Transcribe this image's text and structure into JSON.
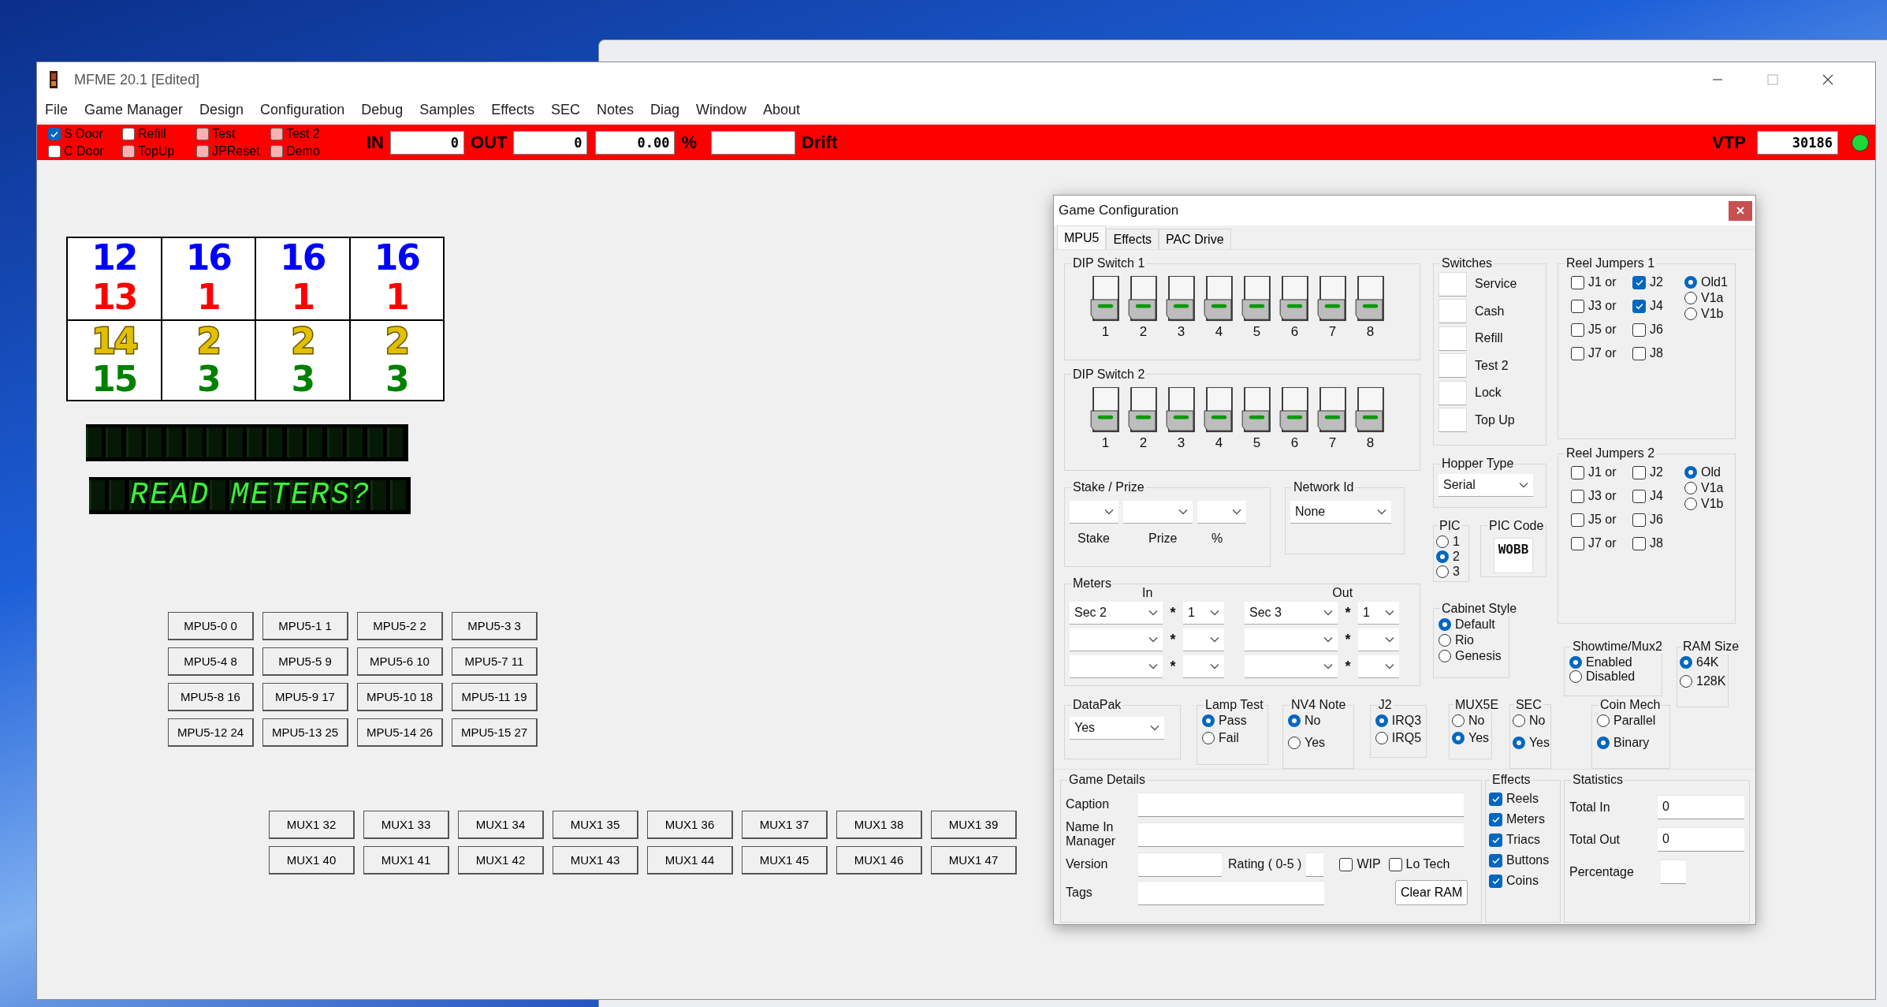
{
  "window": {
    "title": "MFME 20.1 [Edited]"
  },
  "menu": [
    "File",
    "Game Manager",
    "Design",
    "Configuration",
    "Debug",
    "Samples",
    "Effects",
    "SEC",
    "Notes",
    "Diag",
    "Window",
    "About"
  ],
  "toolbar": {
    "checks": [
      {
        "label": "S Door",
        "checked": true
      },
      {
        "label": "C Door",
        "checked": false,
        "color": "#ffffff"
      },
      {
        "label": "Refill",
        "checked": false,
        "color": "#ffffff"
      },
      {
        "label": "TopUp",
        "checked": false,
        "color": "#ffb0b0"
      },
      {
        "label": "Test",
        "checked": false,
        "color": "#ffb0b0"
      },
      {
        "label": "JPReset",
        "checked": false,
        "color": "#ffb0b0"
      },
      {
        "label": "Test 2",
        "checked": false,
        "color": "#ffb0b0"
      },
      {
        "label": "Demo",
        "checked": false,
        "color": "#ffb0b0"
      }
    ],
    "in": {
      "label": "IN",
      "value": "0"
    },
    "out": {
      "label": "OUT",
      "value": "0"
    },
    "percentage": {
      "value": "0.00",
      "unit": "%"
    },
    "drift": {
      "label": "Drift"
    },
    "vtp": {
      "label": "VTP",
      "value": "30186",
      "lamp_on": true
    }
  },
  "reels": [
    {
      "symbols": [
        {
          "text": "12",
          "color": "#0000ff"
        },
        {
          "text": "13",
          "color": "#ff0000"
        },
        {
          "text": "14",
          "color": "#e0c000"
        },
        {
          "text": "15",
          "color": "#008000"
        }
      ]
    },
    {
      "symbols": [
        {
          "text": "16",
          "color": "#0000ff"
        },
        {
          "text": "1",
          "color": "#ff0000"
        },
        {
          "text": "2",
          "color": "#e0c000"
        },
        {
          "text": "3",
          "color": "#008000"
        }
      ]
    },
    {
      "symbols": [
        {
          "text": "16",
          "color": "#0000ff"
        },
        {
          "text": "1",
          "color": "#ff0000"
        },
        {
          "text": "2",
          "color": "#e0c000"
        },
        {
          "text": "3",
          "color": "#008000"
        }
      ]
    },
    {
      "symbols": [
        {
          "text": "16",
          "color": "#0000ff"
        },
        {
          "text": "1",
          "color": "#ff0000"
        },
        {
          "text": "2",
          "color": "#e0c000"
        },
        {
          "text": "3",
          "color": "#008000"
        }
      ]
    }
  ],
  "display": {
    "text": "READ METERS?"
  },
  "lamp_buttons": [
    "MPU5-0 0",
    "MPU5-1 1",
    "MPU5-2 2",
    "MPU5-3 3",
    "MPU5-4 8",
    "MPU5-5 9",
    "MPU5-6 10",
    "MPU5-7 11",
    "MPU5-8 16",
    "MPU5-9 17",
    "MPU5-10 18",
    "MPU5-11 19",
    "MPU5-12 24",
    "MPU5-13 25",
    "MPU5-14 26",
    "MPU5-15 27"
  ],
  "mux_buttons": [
    "MUX1 32",
    "MUX1 33",
    "MUX1 34",
    "MUX1 35",
    "MUX1 36",
    "MUX1 37",
    "MUX1 38",
    "MUX1 39",
    "MUX1 40",
    "MUX1 41",
    "MUX1 42",
    "MUX1 43",
    "MUX1 44",
    "MUX1 45",
    "MUX1 46",
    "MUX1 47"
  ],
  "dialog": {
    "title": "Game Configuration",
    "tabs": [
      {
        "label": "MPU5",
        "selected": true
      },
      {
        "label": "Effects",
        "selected": false
      },
      {
        "label": "PAC Drive",
        "selected": false
      }
    ],
    "dip_switches": [
      {
        "title": "DIP Switch 1",
        "switches": [
          {
            "label": "1",
            "on": false
          },
          {
            "label": "2",
            "on": false
          },
          {
            "label": "3",
            "on": false
          },
          {
            "label": "4",
            "on": false
          },
          {
            "label": "5",
            "on": false
          },
          {
            "label": "6",
            "on": false
          },
          {
            "label": "7",
            "on": false
          },
          {
            "label": "8",
            "on": false
          }
        ]
      },
      {
        "title": "DIP Switch 2",
        "switches": [
          {
            "label": "1",
            "on": false
          },
          {
            "label": "2",
            "on": false
          },
          {
            "label": "3",
            "on": false
          },
          {
            "label": "4",
            "on": false
          },
          {
            "label": "5",
            "on": false
          },
          {
            "label": "6",
            "on": false
          },
          {
            "label": "7",
            "on": false
          },
          {
            "label": "8",
            "on": false
          }
        ]
      }
    ],
    "switches": {
      "title": "Switches",
      "items": [
        "Service",
        "Cash",
        "Refill",
        "Test 2",
        "Lock",
        "Top Up"
      ]
    },
    "reel_jumpers": [
      {
        "title": "Reel Jumpers 1",
        "jumpers": [
          {
            "label": "J1 or",
            "checked": false
          },
          {
            "label": "J2",
            "checked": true
          },
          {
            "label": "J3 or",
            "checked": false
          },
          {
            "label": "J4",
            "checked": true
          },
          {
            "label": "J5 or",
            "checked": false
          },
          {
            "label": "J6",
            "checked": false
          },
          {
            "label": "J7 or",
            "checked": false
          },
          {
            "label": "J8",
            "checked": false
          }
        ],
        "options": [
          {
            "label": "Old1",
            "selected": true
          },
          {
            "label": "V1a",
            "selected": false
          },
          {
            "label": "V1b",
            "selected": false
          }
        ]
      },
      {
        "title": "Reel Jumpers 2",
        "jumpers": [
          {
            "label": "J1 or",
            "checked": false
          },
          {
            "label": "J2",
            "checked": false
          },
          {
            "label": "J3 or",
            "checked": false
          },
          {
            "label": "J4",
            "checked": false
          },
          {
            "label": "J5 or",
            "checked": false
          },
          {
            "label": "J6",
            "checked": false
          },
          {
            "label": "J7 or",
            "checked": false
          },
          {
            "label": "J8",
            "checked": false
          }
        ],
        "options": [
          {
            "label": "Old",
            "selected": true
          },
          {
            "label": "V1a",
            "selected": false
          },
          {
            "label": "V1b",
            "selected": false
          }
        ]
      }
    ],
    "stake_prize": {
      "title": "Stake / Prize",
      "labels": [
        "Stake",
        "Prize",
        "%"
      ]
    },
    "network_id": {
      "title": "Network Id",
      "value": "None"
    },
    "hopper_type": {
      "title": "Hopper Type",
      "value": "Serial"
    },
    "pic": {
      "title": "PIC",
      "options": [
        {
          "label": "1",
          "selected": false
        },
        {
          "label": "2",
          "selected": true
        },
        {
          "label": "3",
          "selected": false
        }
      ]
    },
    "pic_code": {
      "title": "PIC Code",
      "value": "WOBB"
    },
    "meters": {
      "title": "Meters",
      "in_label": "In",
      "out_label": "Out",
      "rows": [
        {
          "in": "Sec 2",
          "in_sign": "*",
          "in_factor": "1",
          "out": "Sec 3",
          "out_sign": "*",
          "out_factor": "1"
        },
        {
          "in_sign": "*",
          "out_sign": "*"
        },
        {
          "in_sign": "*",
          "out_sign": "*"
        }
      ]
    },
    "cabinet_style": {
      "title": "Cabinet Style",
      "options": [
        {
          "label": "Default",
          "selected": true
        },
        {
          "label": "Rio",
          "selected": false
        },
        {
          "label": "Genesis",
          "selected": false
        }
      ]
    },
    "showtime_mux2": {
      "title": "Showtime/Mux2",
      "options": [
        {
          "label": "Enabled",
          "selected": true
        },
        {
          "label": "Disabled",
          "selected": false
        }
      ]
    },
    "ram_size": {
      "title": "RAM Size",
      "options": [
        {
          "label": "64K",
          "selected": true
        },
        {
          "label": "128K",
          "selected": false
        }
      ]
    },
    "datapak": {
      "title": "DataPak",
      "value": "Yes"
    },
    "lamp_test": {
      "title": "Lamp Test",
      "options": [
        {
          "label": "Pass",
          "selected": true
        },
        {
          "label": "Fail",
          "selected": false
        }
      ]
    },
    "nv4_note": {
      "title": "NV4 Note",
      "options": [
        {
          "label": "No",
          "selected": true
        },
        {
          "label": "Yes",
          "selected": false
        }
      ]
    },
    "j2": {
      "title": "J2",
      "options": [
        {
          "label": "IRQ3",
          "selected": true
        },
        {
          "label": "IRQ5",
          "selected": false
        }
      ]
    },
    "mux5e": {
      "title": "MUX5E",
      "options": [
        {
          "label": "No",
          "selected": false
        },
        {
          "label": "Yes",
          "selected": true
        }
      ]
    },
    "sec": {
      "title": "SEC",
      "options": [
        {
          "label": "No",
          "selected": false
        },
        {
          "label": "Yes",
          "selected": true
        }
      ]
    },
    "coin_mech": {
      "title": "Coin Mech",
      "options": [
        {
          "label": "Parallel",
          "selected": false
        },
        {
          "label": "Binary",
          "selected": true
        }
      ]
    },
    "game_details": {
      "title": "Game Details",
      "caption_label": "Caption",
      "name_label": "Name In Manager",
      "version_label": "Version",
      "rating_label": "Rating ( 0-5 )",
      "wip": {
        "label": "WIP",
        "checked": false
      },
      "lo_tech": {
        "label": "Lo Tech",
        "checked": false
      },
      "tags_label": "Tags",
      "clear_button": "Clear RAM"
    },
    "effects": {
      "title": "Effects",
      "items": [
        {
          "label": "Reels",
          "checked": true
        },
        {
          "label": "Meters",
          "checked": true
        },
        {
          "label": "Triacs",
          "checked": true
        },
        {
          "label": "Buttons",
          "checked": true
        },
        {
          "label": "Coins",
          "checked": true
        }
      ]
    },
    "statistics": {
      "title": "Statistics",
      "total_in": {
        "label": "Total In",
        "value": "0"
      },
      "total_out": {
        "label": "Total Out",
        "value": "0"
      },
      "percentage": {
        "label": "Percentage"
      }
    }
  }
}
